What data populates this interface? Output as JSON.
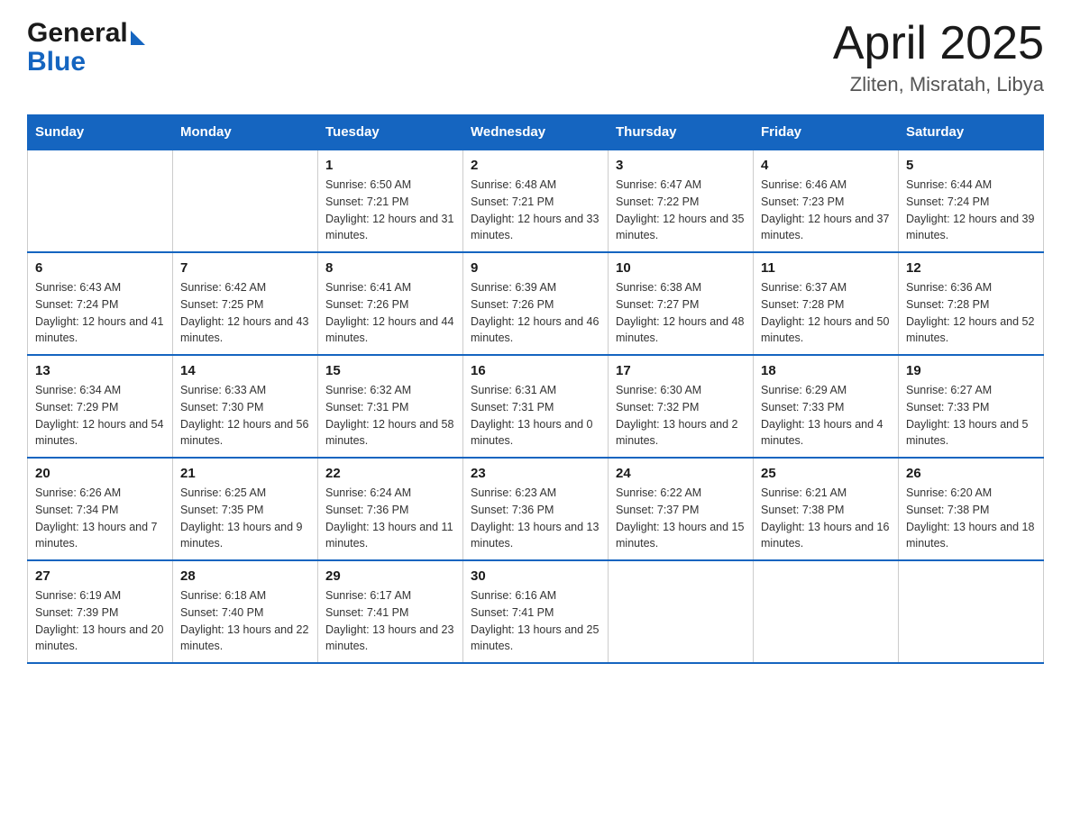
{
  "header": {
    "logo_general": "General",
    "logo_blue": "Blue",
    "month_title": "April 2025",
    "location": "Zliten, Misratah, Libya"
  },
  "weekdays": [
    "Sunday",
    "Monday",
    "Tuesday",
    "Wednesday",
    "Thursday",
    "Friday",
    "Saturday"
  ],
  "weeks": [
    [
      {
        "day": "",
        "sunrise": "",
        "sunset": "",
        "daylight": ""
      },
      {
        "day": "",
        "sunrise": "",
        "sunset": "",
        "daylight": ""
      },
      {
        "day": "1",
        "sunrise": "Sunrise: 6:50 AM",
        "sunset": "Sunset: 7:21 PM",
        "daylight": "Daylight: 12 hours and 31 minutes."
      },
      {
        "day": "2",
        "sunrise": "Sunrise: 6:48 AM",
        "sunset": "Sunset: 7:21 PM",
        "daylight": "Daylight: 12 hours and 33 minutes."
      },
      {
        "day": "3",
        "sunrise": "Sunrise: 6:47 AM",
        "sunset": "Sunset: 7:22 PM",
        "daylight": "Daylight: 12 hours and 35 minutes."
      },
      {
        "day": "4",
        "sunrise": "Sunrise: 6:46 AM",
        "sunset": "Sunset: 7:23 PM",
        "daylight": "Daylight: 12 hours and 37 minutes."
      },
      {
        "day": "5",
        "sunrise": "Sunrise: 6:44 AM",
        "sunset": "Sunset: 7:24 PM",
        "daylight": "Daylight: 12 hours and 39 minutes."
      }
    ],
    [
      {
        "day": "6",
        "sunrise": "Sunrise: 6:43 AM",
        "sunset": "Sunset: 7:24 PM",
        "daylight": "Daylight: 12 hours and 41 minutes."
      },
      {
        "day": "7",
        "sunrise": "Sunrise: 6:42 AM",
        "sunset": "Sunset: 7:25 PM",
        "daylight": "Daylight: 12 hours and 43 minutes."
      },
      {
        "day": "8",
        "sunrise": "Sunrise: 6:41 AM",
        "sunset": "Sunset: 7:26 PM",
        "daylight": "Daylight: 12 hours and 44 minutes."
      },
      {
        "day": "9",
        "sunrise": "Sunrise: 6:39 AM",
        "sunset": "Sunset: 7:26 PM",
        "daylight": "Daylight: 12 hours and 46 minutes."
      },
      {
        "day": "10",
        "sunrise": "Sunrise: 6:38 AM",
        "sunset": "Sunset: 7:27 PM",
        "daylight": "Daylight: 12 hours and 48 minutes."
      },
      {
        "day": "11",
        "sunrise": "Sunrise: 6:37 AM",
        "sunset": "Sunset: 7:28 PM",
        "daylight": "Daylight: 12 hours and 50 minutes."
      },
      {
        "day": "12",
        "sunrise": "Sunrise: 6:36 AM",
        "sunset": "Sunset: 7:28 PM",
        "daylight": "Daylight: 12 hours and 52 minutes."
      }
    ],
    [
      {
        "day": "13",
        "sunrise": "Sunrise: 6:34 AM",
        "sunset": "Sunset: 7:29 PM",
        "daylight": "Daylight: 12 hours and 54 minutes."
      },
      {
        "day": "14",
        "sunrise": "Sunrise: 6:33 AM",
        "sunset": "Sunset: 7:30 PM",
        "daylight": "Daylight: 12 hours and 56 minutes."
      },
      {
        "day": "15",
        "sunrise": "Sunrise: 6:32 AM",
        "sunset": "Sunset: 7:31 PM",
        "daylight": "Daylight: 12 hours and 58 minutes."
      },
      {
        "day": "16",
        "sunrise": "Sunrise: 6:31 AM",
        "sunset": "Sunset: 7:31 PM",
        "daylight": "Daylight: 13 hours and 0 minutes."
      },
      {
        "day": "17",
        "sunrise": "Sunrise: 6:30 AM",
        "sunset": "Sunset: 7:32 PM",
        "daylight": "Daylight: 13 hours and 2 minutes."
      },
      {
        "day": "18",
        "sunrise": "Sunrise: 6:29 AM",
        "sunset": "Sunset: 7:33 PM",
        "daylight": "Daylight: 13 hours and 4 minutes."
      },
      {
        "day": "19",
        "sunrise": "Sunrise: 6:27 AM",
        "sunset": "Sunset: 7:33 PM",
        "daylight": "Daylight: 13 hours and 5 minutes."
      }
    ],
    [
      {
        "day": "20",
        "sunrise": "Sunrise: 6:26 AM",
        "sunset": "Sunset: 7:34 PM",
        "daylight": "Daylight: 13 hours and 7 minutes."
      },
      {
        "day": "21",
        "sunrise": "Sunrise: 6:25 AM",
        "sunset": "Sunset: 7:35 PM",
        "daylight": "Daylight: 13 hours and 9 minutes."
      },
      {
        "day": "22",
        "sunrise": "Sunrise: 6:24 AM",
        "sunset": "Sunset: 7:36 PM",
        "daylight": "Daylight: 13 hours and 11 minutes."
      },
      {
        "day": "23",
        "sunrise": "Sunrise: 6:23 AM",
        "sunset": "Sunset: 7:36 PM",
        "daylight": "Daylight: 13 hours and 13 minutes."
      },
      {
        "day": "24",
        "sunrise": "Sunrise: 6:22 AM",
        "sunset": "Sunset: 7:37 PM",
        "daylight": "Daylight: 13 hours and 15 minutes."
      },
      {
        "day": "25",
        "sunrise": "Sunrise: 6:21 AM",
        "sunset": "Sunset: 7:38 PM",
        "daylight": "Daylight: 13 hours and 16 minutes."
      },
      {
        "day": "26",
        "sunrise": "Sunrise: 6:20 AM",
        "sunset": "Sunset: 7:38 PM",
        "daylight": "Daylight: 13 hours and 18 minutes."
      }
    ],
    [
      {
        "day": "27",
        "sunrise": "Sunrise: 6:19 AM",
        "sunset": "Sunset: 7:39 PM",
        "daylight": "Daylight: 13 hours and 20 minutes."
      },
      {
        "day": "28",
        "sunrise": "Sunrise: 6:18 AM",
        "sunset": "Sunset: 7:40 PM",
        "daylight": "Daylight: 13 hours and 22 minutes."
      },
      {
        "day": "29",
        "sunrise": "Sunrise: 6:17 AM",
        "sunset": "Sunset: 7:41 PM",
        "daylight": "Daylight: 13 hours and 23 minutes."
      },
      {
        "day": "30",
        "sunrise": "Sunrise: 6:16 AM",
        "sunset": "Sunset: 7:41 PM",
        "daylight": "Daylight: 13 hours and 25 minutes."
      },
      {
        "day": "",
        "sunrise": "",
        "sunset": "",
        "daylight": ""
      },
      {
        "day": "",
        "sunrise": "",
        "sunset": "",
        "daylight": ""
      },
      {
        "day": "",
        "sunrise": "",
        "sunset": "",
        "daylight": ""
      }
    ]
  ]
}
